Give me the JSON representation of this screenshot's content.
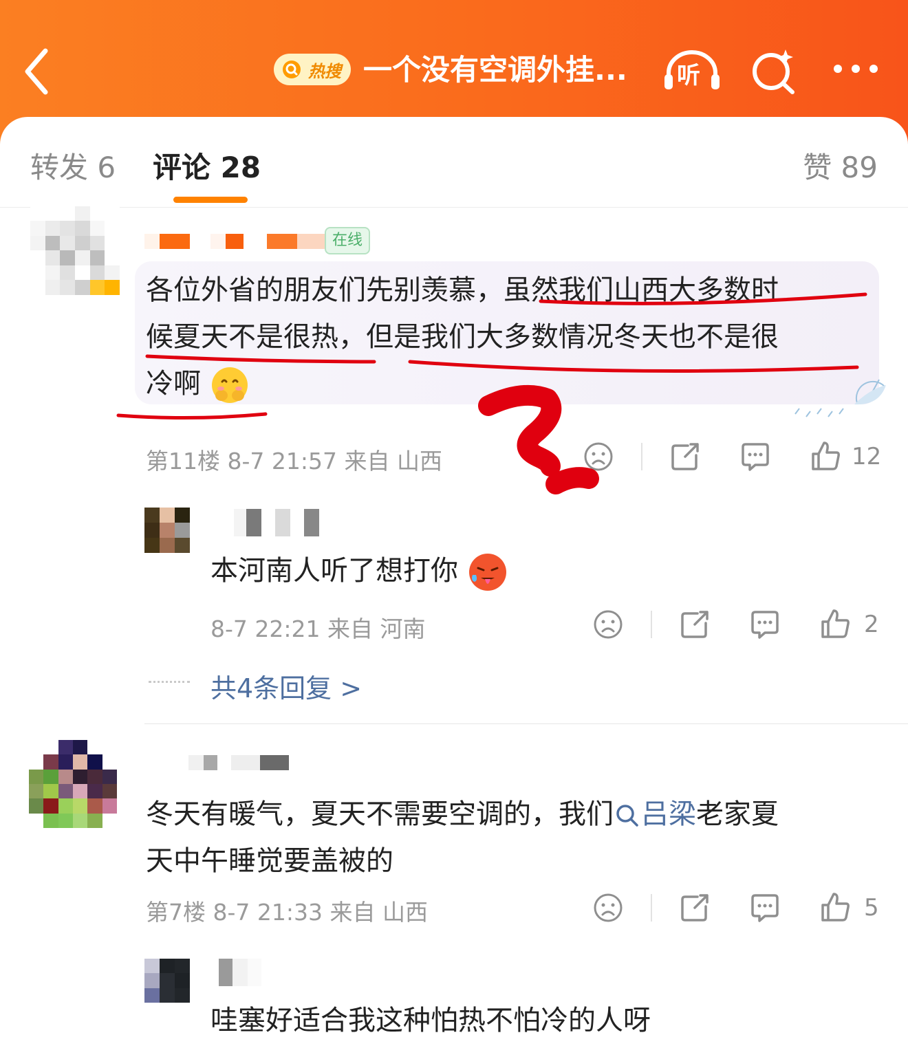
{
  "header": {
    "back_icon": "chevron-left-icon",
    "hot_badge": "热搜",
    "title": "一个没有空调外挂...",
    "listen_label": "听",
    "search_icon": "search-sparkle-icon",
    "more_icon": "more-dots-icon",
    "color_start": "#fb7f22",
    "color_end": "#f8541a"
  },
  "tabs": {
    "repost": "转发 6",
    "comment": "评论 28",
    "like": "赞 89",
    "active_color": "#ff8200"
  },
  "comments": [
    {
      "badge": "在线",
      "text_a": "各位外省的朋友们先别羡慕，虽然我们山西大多数时",
      "text_b": "候夏天不是很热，但是我们大多数情况冬天也不是很",
      "text_c": "冷啊",
      "emoji": "shy-face-emoji",
      "meta": "第11楼  8-7 21:57  来自 山西",
      "likes": "12",
      "reply": {
        "text": "本河南人听了想打你",
        "emoji": "hot-face-emoji",
        "meta": "8-7 22:21  来自 河南",
        "likes": "2"
      },
      "more_replies": "共4条回复 >"
    },
    {
      "text_a": "冬天有暖气，夏天不需要空调的，我们",
      "topic": "吕梁",
      "text_a2": "老家夏",
      "text_b": "天中午睡觉要盖被的",
      "meta": "第7楼  8-7 21:33  来自 山西",
      "likes": "5",
      "reply": {
        "text": "哇塞好适合我这种怕热不怕冷的人呀"
      }
    }
  ],
  "accent_link_color": "#4e6fa0",
  "annotation_color": "#e0000f"
}
